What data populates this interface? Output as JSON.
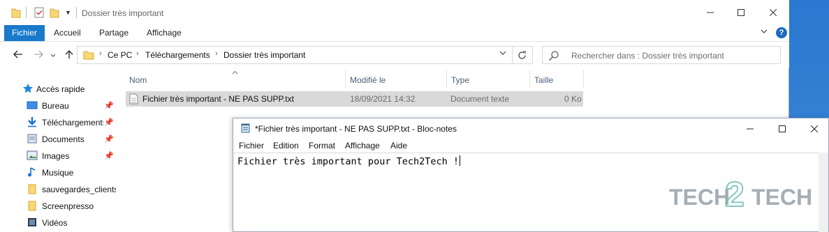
{
  "explorer": {
    "title": "Dossier très important",
    "ribbon_tabs": [
      "Fichier",
      "Accueil",
      "Partage",
      "Affichage"
    ],
    "help_label": "?",
    "breadcrumb": [
      "Ce PC",
      "Téléchargements",
      "Dossier très important"
    ],
    "search_placeholder": "Rechercher dans : Dossier très important",
    "columns": [
      "Nom",
      "Modifié le",
      "Type",
      "Taille"
    ],
    "files": [
      {
        "name": "Fichier très important - NE PAS SUPP.txt",
        "modified": "18/09/2021 14:32",
        "type": "Document texte",
        "size": "0 Ko"
      }
    ],
    "sidebar": [
      {
        "label": "Accès rapide",
        "icon": "star-icon",
        "pinned": false
      },
      {
        "label": "Bureau",
        "icon": "desktop-icon",
        "pinned": true
      },
      {
        "label": "Téléchargements",
        "icon": "download-icon",
        "pinned": true
      },
      {
        "label": "Documents",
        "icon": "documents-icon",
        "pinned": true
      },
      {
        "label": "Images",
        "icon": "images-icon",
        "pinned": true
      },
      {
        "label": "Musique",
        "icon": "music-icon",
        "pinned": false
      },
      {
        "label": "sauvegardes_clients",
        "icon": "folder-icon",
        "pinned": false
      },
      {
        "label": "Screenpresso",
        "icon": "folder-icon",
        "pinned": false
      },
      {
        "label": "Vidéos",
        "icon": "videos-icon",
        "pinned": false
      }
    ]
  },
  "notepad": {
    "title": "*Fichier très important - NE PAS SUPP.txt - Bloc-notes",
    "menu": [
      "Fichier",
      "Edition",
      "Format",
      "Affichage",
      "Aide"
    ],
    "content": "Fichier très important pour Tech2Tech !"
  },
  "watermark": {
    "left": "TECH",
    "right": "TECH",
    "middle": "2"
  },
  "colors": {
    "accent": "#1979ca",
    "selection": "#d9d9d9",
    "desktop": "#2f7fd1",
    "folder": "#f8d775"
  }
}
